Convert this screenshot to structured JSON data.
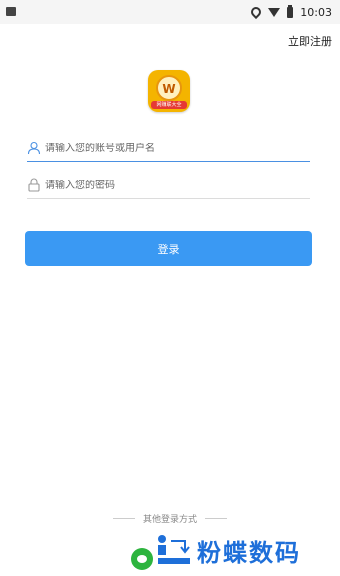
{
  "status_bar": {
    "time": "10:03",
    "icons": [
      "location-icon",
      "wifi-icon",
      "battery-icon"
    ]
  },
  "header": {
    "register_label": "立即注册"
  },
  "logo": {
    "lettermark": "W",
    "banner_text": "网赚联大全"
  },
  "form": {
    "username_placeholder": "请输入您的账号或用户名",
    "password_placeholder": "请输入您的密码",
    "login_label": "登录"
  },
  "other_login": {
    "label": "其他登录方式",
    "methods": [
      "wechat-icon"
    ]
  },
  "watermark": {
    "text": "粉蝶数码"
  },
  "colors": {
    "accent": "#3a99f3",
    "active_underline": "#4a90e2",
    "wechat": "#2db43e",
    "watermark": "#1e6fd9"
  }
}
